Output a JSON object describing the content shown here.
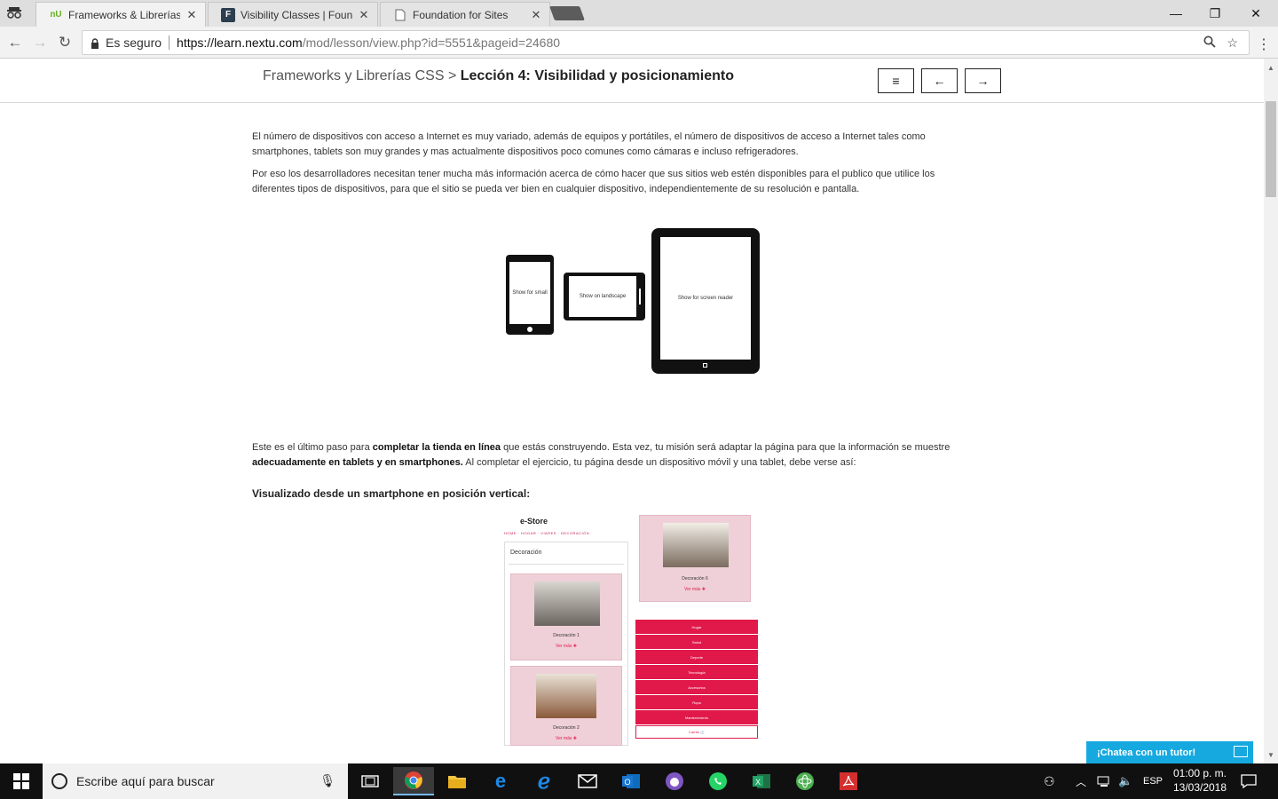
{
  "browser": {
    "tabs": [
      {
        "favicon": "nU",
        "title": "Frameworks & Librerías CSS",
        "close": "✕"
      },
      {
        "favicon": "F",
        "title": "Visibility Classes | Foundation",
        "close": "✕"
      },
      {
        "favicon": "page",
        "title": "Foundation for Sites",
        "close": "✕"
      }
    ],
    "window_controls": {
      "minimize": "—",
      "restore": "❐",
      "close": "✕"
    },
    "secure_label": "Es seguro",
    "url_host": "https://learn.nextu.com",
    "url_path": "/mod/lesson/view.php?id=5551&pageid=24680"
  },
  "header": {
    "course": "Frameworks y Librerías CSS",
    "separator": ">",
    "lesson": "Lección 4: Visibilidad y posicionamiento",
    "menu_button": "≡",
    "prev_button": "←",
    "next_button": "→"
  },
  "content": {
    "p1": "El número de dispositivos con acceso a Internet es muy variado, además de equipos y portátiles, el número de dispositivos de acceso a Internet tales como smartphones, tablets son muy grandes y mas actualmente dispositivos poco comunes como cámaras e incluso refrigeradores.",
    "p2": "Por eso los desarrolladores necesitan tener mucha más información acerca de cómo hacer que sus sitios web estén disponibles para el publico que utilice los diferentes tipos de dispositivos, para que el sitio se pueda ver bien en cualquier dispositivo, independientemente de su resolución e pantalla.",
    "p3_a": "Este es el último paso para ",
    "p3_b": "completar la tienda en línea",
    "p3_c": " que estás construyendo. Esta vez, tu misión será adaptar la página para que la información se muestre ",
    "p3_d": "adecuadamente en tablets y en smartphones.",
    "p3_e": " Al completar el ejercicio, tu página desde un dispositivo móvil y una tablet, debe verse así:",
    "p4": "Visualizado desde un smartphone en posición vertical:"
  },
  "devices": {
    "phone": "Show for small",
    "landscape": "Show on landscape",
    "tablet": "Show for screen reader"
  },
  "mockup": {
    "logo": "e-Store",
    "crumbs": "HOME · HOGAR · VIARES · DECORACIÓN",
    "section_title": "Decoración",
    "cards": [
      {
        "caption": "Decoración 1",
        "more": "Ver más ✚"
      },
      {
        "caption": "Decoración 2",
        "more": "Ver más ✚"
      },
      {
        "caption": "Decoración 6",
        "more": "Ver más ✚"
      }
    ],
    "menu": [
      "Hogar",
      "Salud",
      "Deporte",
      "Tecnología",
      "Accesorios",
      "Ropa",
      "Mantenimiento"
    ],
    "cart": "Carrito 🛒"
  },
  "chat": {
    "label": "¡Chatea con un tutor!"
  },
  "taskbar": {
    "search_placeholder": "Escribe aquí para buscar",
    "lang": "ESP",
    "time": "01:00 p. m.",
    "date": "13/03/2018"
  },
  "colors": {
    "accent": "#e0194a",
    "chat": "#16a9e0",
    "taskbar": "#101010"
  }
}
